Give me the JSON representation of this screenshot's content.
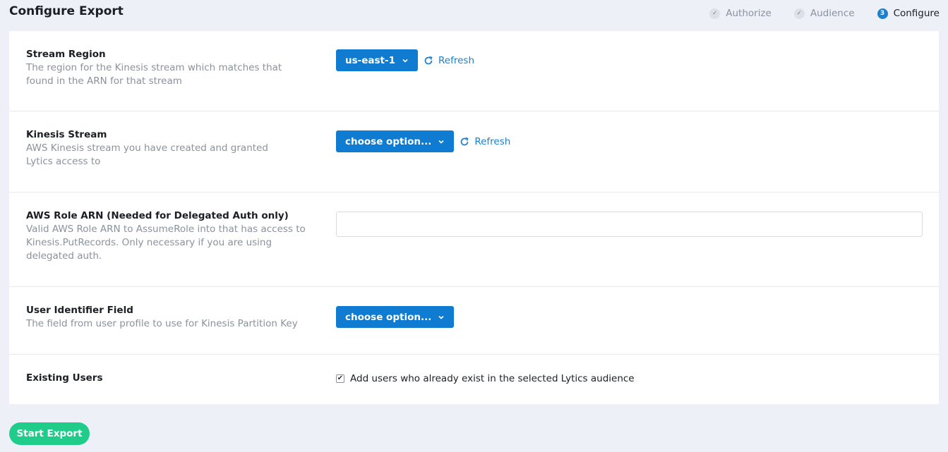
{
  "page": {
    "title": "Configure Export"
  },
  "steps": [
    {
      "badge": "✓",
      "label": "Authorize",
      "state": "done"
    },
    {
      "badge": "✓",
      "label": "Audience",
      "state": "done"
    },
    {
      "badge": "3",
      "label": "Configure",
      "state": "active"
    }
  ],
  "fields": {
    "stream_region": {
      "title": "Stream Region",
      "description": "The region for the Kinesis stream which matches that found in the ARN for that stream",
      "dropdown_value": "us-east-1",
      "refresh_label": "Refresh"
    },
    "kinesis_stream": {
      "title": "Kinesis Stream",
      "description": "AWS Kinesis stream you have created and granted Lytics access to",
      "dropdown_value": "choose option...",
      "refresh_label": "Refresh"
    },
    "aws_role_arn": {
      "title": "AWS Role ARN (Needed for Delegated Auth only)",
      "description": "Valid AWS Role ARN to AssumeRole into that has access to Kinesis.PutRecords. Only necessary if you are using delegated auth.",
      "value": "",
      "placeholder": ""
    },
    "user_identifier": {
      "title": "User Identifier Field",
      "description": "The field from user profile to use for Kinesis Partition Key",
      "dropdown_value": "choose option..."
    },
    "existing_users": {
      "title": "Existing Users",
      "checkbox_label": "Add users who already exist in the selected Lytics audience",
      "checked": true
    }
  },
  "actions": {
    "start_export_label": "Start Export"
  },
  "colors": {
    "primary": "#0f7bd1",
    "link": "#1b80d0",
    "success": "#1fcc8a",
    "background": "#edf0f7",
    "muted_text": "#8a929c"
  },
  "icons": {
    "refresh": "refresh-icon",
    "dropdown": "chevron-down-icon",
    "step_done": "check-icon"
  }
}
